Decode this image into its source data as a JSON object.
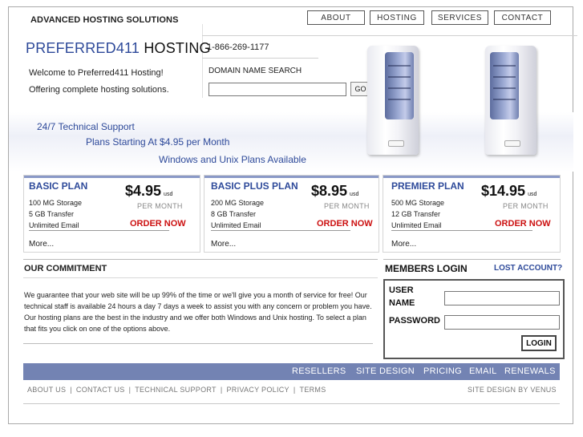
{
  "header": {
    "company": "ADVANCED HOSTING SOLUTIONS",
    "nav": [
      "ABOUT",
      "HOSTING",
      "SERVICES",
      "CONTACT"
    ],
    "brand_main": "PREFERRED411",
    "brand_suffix": "HOSTING",
    "phone": "1-866-269-1177",
    "welcome": "Welcome to Preferred411 Hosting!",
    "offering": "Offering complete hosting solutions.",
    "domain_label": "DOMAIN NAME SEARCH",
    "domain_placeholder": "",
    "go_label": "GO"
  },
  "banner": {
    "line1": "24/7 Technical Support",
    "line2": "Plans Starting At $4.95 per Month",
    "line3": "Windows and Unix Plans Available"
  },
  "plans": [
    {
      "name": "BASIC PLAN",
      "price": "$4.95",
      "currency": "usd",
      "period": "PER MONTH",
      "features": [
        "100 MG Storage",
        "5 GB Transfer",
        "Unlimited Email"
      ],
      "order": "ORDER NOW",
      "more": "More..."
    },
    {
      "name": "BASIC PLUS PLAN",
      "price": "$8.95",
      "currency": "usd",
      "period": "PER MONTH",
      "features": [
        "200 MG Storage",
        "8 GB Transfer",
        "Unlimited Email"
      ],
      "order": "ORDER NOW",
      "more": "More..."
    },
    {
      "name": "PREMIER PLAN",
      "price": "$14.95",
      "currency": "usd",
      "period": "PER MONTH",
      "features": [
        "500 MG Storage",
        "12 GB Transfer",
        "Unlimited Email"
      ],
      "order": "ORDER NOW",
      "more": "More..."
    }
  ],
  "commitment": {
    "title": "OUR COMMITMENT",
    "text": "We guarantee that your web site will be up 99% of the time or we'll give you a month of service for free! Our technical staff is available 24 hours a day 7 days a week to assist you with any concern or problem you have. Our hosting plans are the best in the industry and we offer both Windows and Unix hosting. To select a plan that fits you click on one of the options above."
  },
  "login": {
    "title": "MEMBERS LOGIN",
    "lost": "LOST ACCOUNT?",
    "user_label_1": "USER",
    "user_label_2": "NAME",
    "password_label": "PASSWORD",
    "button": "LOGIN"
  },
  "footer": {
    "links": [
      "RESELLERS",
      "SITE DESIGN",
      "PRICING",
      "EMAIL",
      "RENEWALS"
    ],
    "bottom_links": [
      "ABOUT US",
      "CONTACT US",
      "TECHNICAL SUPPORT",
      "PRIVACY POLICY",
      "TERMS"
    ],
    "separator": "|",
    "credit": "SITE DESIGN BY VENUS"
  },
  "colors": {
    "brand_blue": "#2e4a9a",
    "footer_bar": "#7383b3",
    "order_red": "#cc1111"
  }
}
